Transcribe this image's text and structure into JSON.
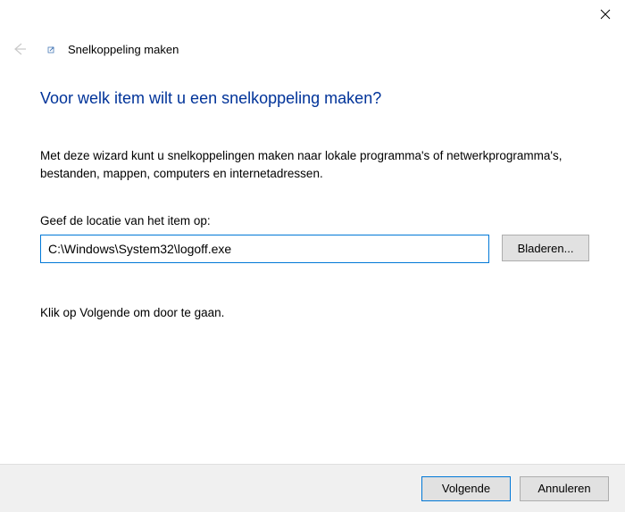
{
  "window": {
    "title": "Snelkoppeling maken"
  },
  "content": {
    "heading": "Voor welk item wilt u een snelkoppeling maken?",
    "description": "Met deze wizard kunt u snelkoppelingen maken naar lokale programma's of netwerkprogramma's, bestanden, mappen, computers en internetadressen.",
    "input_label": "Geef de locatie van het item op:",
    "input_value": "C:\\Windows\\System32\\logoff.exe",
    "browse_label": "Bladeren...",
    "instruction": "Klik op Volgende om door te gaan."
  },
  "footer": {
    "next_label": "Volgende",
    "cancel_label": "Annuleren"
  }
}
